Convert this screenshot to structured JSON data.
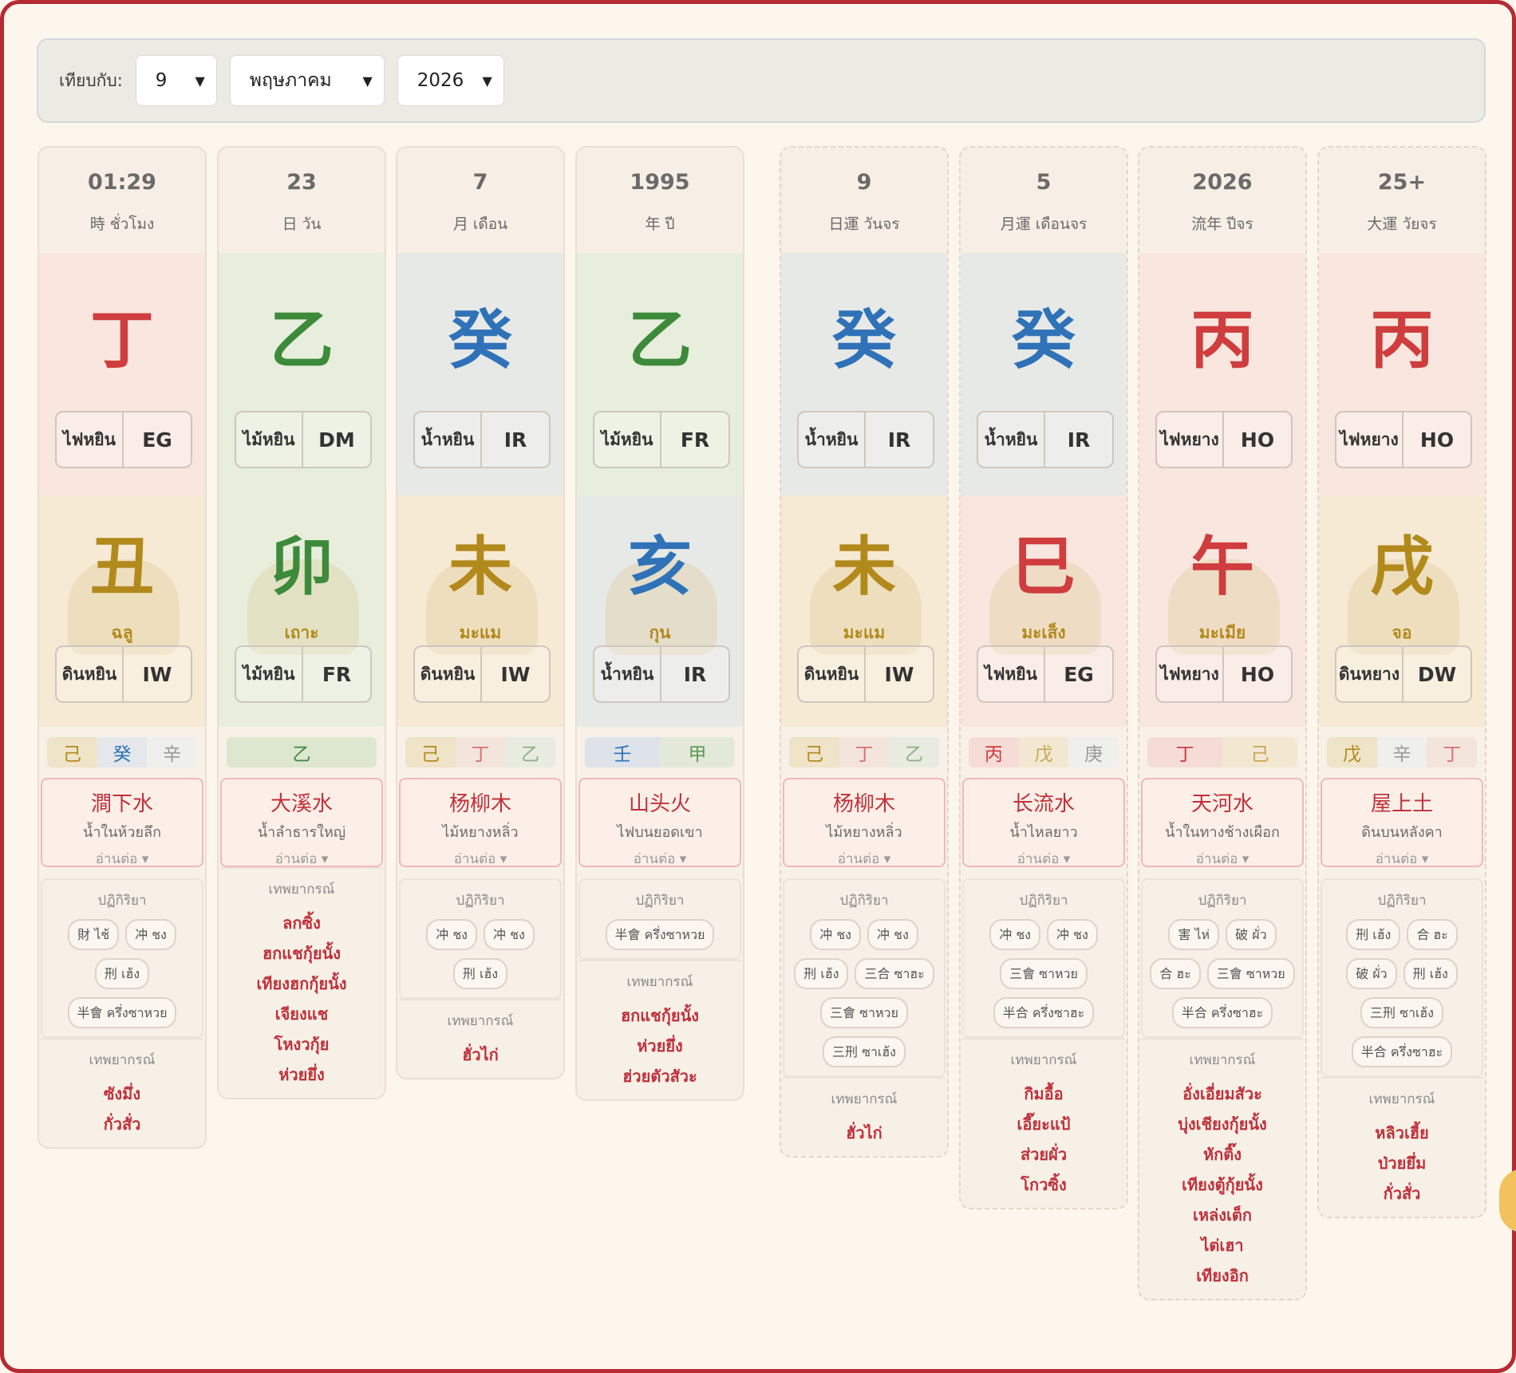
{
  "toolbar": {
    "compare_label": "เทียบกับ:",
    "day": {
      "value": "9"
    },
    "month": {
      "value": "พฤษภาคม"
    },
    "year": {
      "value": "2026"
    }
  },
  "colors": {
    "fire": "#cf3d3e",
    "wood": "#3d8a3b",
    "water": "#2f72b8",
    "earth": "#b2891b",
    "metal": "#9a9a9a",
    "accent": "#b52a33"
  },
  "columns": [
    {
      "num": "01:29",
      "label": "時 ชั่วโมง",
      "dashed": false,
      "stem": {
        "char": "丁",
        "color": "#cf3d3e",
        "bg": "#f9e6de",
        "tag": "ไฟหยิน",
        "code": "EG"
      },
      "branch": {
        "char": "丑",
        "color": "#b2891b",
        "bg": "#f6ead4",
        "animal": "ฉลู",
        "tag": "ดินหยิน",
        "code": "IW"
      },
      "hidden": [
        {
          "c": "己",
          "fg": "#b2891b",
          "bg": "#efe3c8"
        },
        {
          "c": "癸",
          "fg": "#2f72b8",
          "bg": "#e4e8ea"
        },
        {
          "c": "辛",
          "fg": "#9a9a9a",
          "bg": "#efefec"
        }
      ],
      "nayin": {
        "cn": "澗下水",
        "th": "น้ำในห้วยลึก",
        "more": "อ่านต่อ ▾"
      },
      "reactions_title": "ปฏิกิริยา",
      "reactions": [
        "財 ไช้",
        "冲 ชง",
        "刑 เฮ้ง",
        "半會 ครึ่งซาหวย"
      ],
      "pred_title": "เทพยากรณ์",
      "predictions": [
        "ซังมึ่ง",
        "กั่วสั่ว"
      ]
    },
    {
      "num": "23",
      "label": "日 วัน",
      "dashed": false,
      "stem": {
        "char": "乙",
        "color": "#3d8a3b",
        "bg": "#e7eedc",
        "tag": "ไม้หยิน",
        "code": "DM"
      },
      "branch": {
        "char": "卯",
        "color": "#3d8a3b",
        "bg": "#e7eedc",
        "animal": "เถาะ",
        "tag": "ไม้หยิน",
        "code": "FR"
      },
      "hidden": [
        {
          "c": "乙",
          "fg": "#3d8a3b",
          "bg": "#dde6cf"
        }
      ],
      "nayin": {
        "cn": "大溪水",
        "th": "น้ำลำธารใหญ่",
        "more": "อ่านต่อ ▾"
      },
      "reactions_title": "",
      "reactions": [],
      "pred_title": "เทพยากรณ์",
      "predictions": [
        "ลกซิ้ง",
        "ฮกแชกุ้ยนั้ง",
        "เทียงฮกกุ้ยนั้ง",
        "เจียงแช",
        "โหงวกุ้ย",
        "ห่วยยึ่ง"
      ]
    },
    {
      "num": "7",
      "label": "月 เดือน",
      "dashed": false,
      "stem": {
        "char": "癸",
        "color": "#2f72b8",
        "bg": "#e7e9e6",
        "tag": "น้ำหยิน",
        "code": "IR"
      },
      "branch": {
        "char": "未",
        "color": "#b2891b",
        "bg": "#f6ead4",
        "animal": "มะแม",
        "tag": "ดินหยิน",
        "code": "IW"
      },
      "hidden": [
        {
          "c": "己",
          "fg": "#b2891b",
          "bg": "#efe3c8"
        },
        {
          "c": "丁",
          "fg": "#d9746f",
          "bg": "#f3e4dc"
        },
        {
          "c": "乙",
          "fg": "#8bb083",
          "bg": "#e8ece0"
        }
      ],
      "nayin": {
        "cn": "杨柳木",
        "th": "ไม้หยางหลิ่ว",
        "more": "อ่านต่อ ▾"
      },
      "reactions_title": "ปฏิกิริยา",
      "reactions": [
        "冲 ชง",
        "冲 ชง",
        "刑 เฮ้ง"
      ],
      "pred_title": "เทพยากรณ์",
      "predictions": [
        "ฮั่วไก่"
      ]
    },
    {
      "num": "1995",
      "label": "年 ปี",
      "dashed": false,
      "stem": {
        "char": "乙",
        "color": "#3d8a3b",
        "bg": "#e7eedc",
        "tag": "ไม้หยิน",
        "code": "FR"
      },
      "branch": {
        "char": "亥",
        "color": "#2f72b8",
        "bg": "#e7e9e6",
        "animal": "กุน",
        "tag": "น้ำหยิน",
        "code": "IR"
      },
      "hidden": [
        {
          "c": "壬",
          "fg": "#2f72b8",
          "bg": "#dde3e8"
        },
        {
          "c": "甲",
          "fg": "#5e9a57",
          "bg": "#e2e9d8"
        }
      ],
      "nayin": {
        "cn": "山头火",
        "th": "ไฟบนยอดเขา",
        "more": "อ่านต่อ ▾"
      },
      "reactions_title": "ปฏิกิริยา",
      "reactions": [
        "半會 ครึ่งซาหวย"
      ],
      "pred_title": "เทพยากรณ์",
      "predictions": [
        "ฮกแชกุ้ยนั้ง",
        "ห่วยยึ่ง",
        "ฮ่วยตัวสัวะ"
      ]
    },
    {
      "num": "9",
      "label": "日運 วันจร",
      "dashed": true,
      "stem": {
        "char": "癸",
        "color": "#2f72b8",
        "bg": "#e7e9e6",
        "tag": "น้ำหยิน",
        "code": "IR"
      },
      "branch": {
        "char": "未",
        "color": "#b2891b",
        "bg": "#f6ead4",
        "animal": "มะแม",
        "tag": "ดินหยิน",
        "code": "IW"
      },
      "hidden": [
        {
          "c": "己",
          "fg": "#b2891b",
          "bg": "#efe3c8"
        },
        {
          "c": "丁",
          "fg": "#d9746f",
          "bg": "#f3e4dc"
        },
        {
          "c": "乙",
          "fg": "#8bb083",
          "bg": "#e8ece0"
        }
      ],
      "nayin": {
        "cn": "杨柳木",
        "th": "ไม้หยางหลิ่ว",
        "more": "อ่านต่อ ▾"
      },
      "reactions_title": "ปฏิกิริยา",
      "reactions": [
        "冲 ชง",
        "冲 ชง",
        "刑 เฮ้ง",
        "三合 ซาฮะ",
        "三會 ซาหวย",
        "三刑 ซาเฮ้ง"
      ],
      "pred_title": "เทพยากรณ์",
      "predictions": [
        "ฮั่วไก่"
      ]
    },
    {
      "num": "5",
      "label": "月運 เดือนจร",
      "dashed": true,
      "stem": {
        "char": "癸",
        "color": "#2f72b8",
        "bg": "#e7e9e6",
        "tag": "น้ำหยิน",
        "code": "IR"
      },
      "branch": {
        "char": "巳",
        "color": "#cf3d3e",
        "bg": "#f9e6de",
        "animal": "มะเส็ง",
        "tag": "ไฟหยิน",
        "code": "EG"
      },
      "hidden": [
        {
          "c": "丙",
          "fg": "#cf3d3e",
          "bg": "#f5dcd6"
        },
        {
          "c": "戊",
          "fg": "#c9a552",
          "bg": "#f2e8d2"
        },
        {
          "c": "庚",
          "fg": "#9a9a9a",
          "bg": "#efefec"
        }
      ],
      "nayin": {
        "cn": "长流水",
        "th": "น้ำไหลยาว",
        "more": "อ่านต่อ ▾"
      },
      "reactions_title": "ปฏิกิริยา",
      "reactions": [
        "冲 ชง",
        "冲 ชง",
        "三會 ซาหวย",
        "半合 ครึ่งซาฮะ"
      ],
      "pred_title": "เทพยากรณ์",
      "predictions": [
        "กิมอื้อ",
        "เอี๊ยะแป้",
        "ส่วยผั่ว",
        "โกวซิ้ง"
      ]
    },
    {
      "num": "2026",
      "label": "流年 ปีจร",
      "dashed": true,
      "stem": {
        "char": "丙",
        "color": "#cf3d3e",
        "bg": "#f9e6de",
        "tag": "ไฟหยาง",
        "code": "HO"
      },
      "branch": {
        "char": "午",
        "color": "#cf3d3e",
        "bg": "#f9e6de",
        "animal": "มะเมีย",
        "tag": "ไฟหยาง",
        "code": "HO"
      },
      "hidden": [
        {
          "c": "丁",
          "fg": "#cf3d3e",
          "bg": "#f5dcd6"
        },
        {
          "c": "己",
          "fg": "#c9a552",
          "bg": "#f2e8d2"
        }
      ],
      "nayin": {
        "cn": "天河水",
        "th": "น้ำในทางช้างเผือก",
        "more": "อ่านต่อ ▾"
      },
      "reactions_title": "ปฏิกิริยา",
      "reactions": [
        "害 ไห่",
        "破 ผั่ว",
        "合 ฮะ",
        "三會 ซาหวย",
        "半合 ครึ่งซาฮะ"
      ],
      "pred_title": "เทพยากรณ์",
      "predictions": [
        "อั่งเอี่ยมสัวะ",
        "บุ่งเชียงกุ้ยนั้ง",
        "หักติ๊ง",
        "เทียงตู้กุ้ยนั้ง",
        "เหล่งเต็ก",
        "ไต่เฮา",
        "เทียงอิก"
      ]
    },
    {
      "num": "25+",
      "label": "大運 วัยจร",
      "dashed": true,
      "stem": {
        "char": "丙",
        "color": "#cf3d3e",
        "bg": "#f9e6de",
        "tag": "ไฟหยาง",
        "code": "HO"
      },
      "branch": {
        "char": "戌",
        "color": "#b2891b",
        "bg": "#f6ead4",
        "animal": "จอ",
        "tag": "ดินหยาง",
        "code": "DW"
      },
      "hidden": [
        {
          "c": "戊",
          "fg": "#b2891b",
          "bg": "#efe3c8"
        },
        {
          "c": "辛",
          "fg": "#9a9a9a",
          "bg": "#efefec"
        },
        {
          "c": "丁",
          "fg": "#d9746f",
          "bg": "#f3e4dc"
        }
      ],
      "nayin": {
        "cn": "屋上土",
        "th": "ดินบนหลังคา",
        "more": "อ่านต่อ ▾"
      },
      "reactions_title": "ปฏิกิริยา",
      "reactions": [
        "刑 เฮ้ง",
        "合 ฮะ",
        "破 ผั่ว",
        "刑 เฮ้ง",
        "三刑 ซาเฮ้ง",
        "半合 ครึ่งซาฮะ"
      ],
      "pred_title": "เทพยากรณ์",
      "predictions": [
        "หลิวเฮี้ย",
        "ป่วยยึ่ม",
        "กั่วสั่ว"
      ]
    }
  ]
}
